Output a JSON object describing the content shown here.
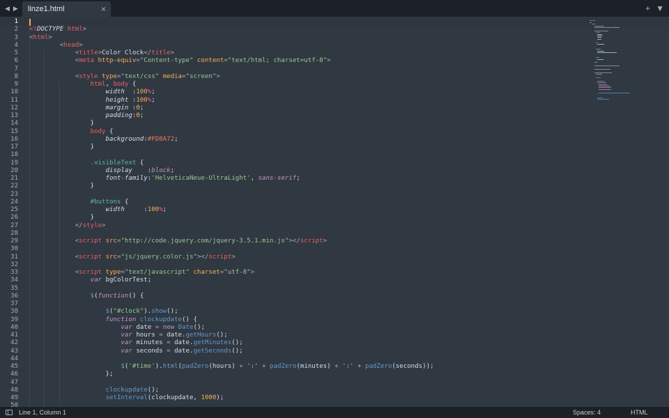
{
  "tab": {
    "title": "linze1.html",
    "close_glyph": "×"
  },
  "nav": {
    "back_glyph": "◀",
    "forward_glyph": "▶"
  },
  "tabbar_right": {
    "new_tab_glyph": "+",
    "menu_glyph": "▼"
  },
  "status": {
    "position": "Line 1, Column 1",
    "spaces": "Spaces: 4",
    "syntax": "HTML"
  },
  "colors": {
    "background": "#303841",
    "bar": "#1b2127",
    "tag": "#ec5f66",
    "attribute": "#f9ae58",
    "string": "#99c794",
    "keyword": "#c695c6",
    "function": "#6699cc"
  },
  "icons": {
    "sidebar_toggle": "sidebar-toggle-icon",
    "back": "chevron-left-icon",
    "forward": "chevron-right-icon",
    "new_tab": "plus-icon",
    "menu": "chevron-down-icon",
    "close": "close-icon"
  },
  "editor": {
    "active_line": 1,
    "lines": [
      [],
      [
        [
          "t",
          "<!"
        ],
        [
          "it",
          "DOCTYPE "
        ],
        [
          "t",
          "html"
        ],
        [
          "cm",
          ">"
        ]
      ],
      [
        [
          "cm",
          "<"
        ],
        [
          "t",
          "html"
        ],
        [
          "cm",
          ">"
        ]
      ],
      [
        [
          "",
          "        "
        ],
        [
          "cm",
          "<"
        ],
        [
          "t",
          "head"
        ],
        [
          "cm",
          ">"
        ]
      ],
      [
        [
          "",
          "            "
        ],
        [
          "cm",
          "<"
        ],
        [
          "t",
          "title"
        ],
        [
          "cm",
          ">"
        ],
        [
          "",
          "Color Clock"
        ],
        [
          "cm",
          "</"
        ],
        [
          "t",
          "title"
        ],
        [
          "cm",
          ">"
        ]
      ],
      [
        [
          "",
          "            "
        ],
        [
          "cm",
          "<"
        ],
        [
          "t",
          "meta "
        ],
        [
          "a",
          "http-equiv"
        ],
        [
          "cm",
          "="
        ],
        [
          "s",
          "\"Content-type\""
        ],
        [
          "a",
          " content"
        ],
        [
          "cm",
          "="
        ],
        [
          "s",
          "\"text/html; charset=utf-8\""
        ],
        [
          "cm",
          ">"
        ]
      ],
      [],
      [
        [
          "",
          "            "
        ],
        [
          "cm",
          "<"
        ],
        [
          "t",
          "style "
        ],
        [
          "a",
          "type"
        ],
        [
          "cm",
          "="
        ],
        [
          "s",
          "\"text/css\""
        ],
        [
          "a",
          " media"
        ],
        [
          "cm",
          "="
        ],
        [
          "s",
          "\"screen\""
        ],
        [
          "cm",
          ">"
        ]
      ],
      [
        [
          "",
          "                "
        ],
        [
          "t",
          "html"
        ],
        [
          "",
          ", "
        ],
        [
          "t",
          "body"
        ],
        [
          "",
          " {"
        ]
      ],
      [
        [
          "",
          "                    "
        ],
        [
          "it",
          "width"
        ],
        [
          "",
          "  :"
        ],
        [
          "n",
          "100"
        ],
        [
          "t",
          "%"
        ],
        [
          "",
          ";"
        ]
      ],
      [
        [
          "",
          "                    "
        ],
        [
          "it",
          "height"
        ],
        [
          "",
          " :"
        ],
        [
          "n",
          "100"
        ],
        [
          "t",
          "%"
        ],
        [
          "",
          ";"
        ]
      ],
      [
        [
          "",
          "                    "
        ],
        [
          "it",
          "margin"
        ],
        [
          "",
          " :"
        ],
        [
          "n",
          "0"
        ],
        [
          "",
          ";"
        ]
      ],
      [
        [
          "",
          "                    "
        ],
        [
          "it",
          "padding"
        ],
        [
          "",
          ":"
        ],
        [
          "n",
          "0"
        ],
        [
          "",
          ";"
        ]
      ],
      [
        [
          "",
          "                }"
        ]
      ],
      [
        [
          "",
          "                "
        ],
        [
          "t",
          "body"
        ],
        [
          "",
          " {"
        ]
      ],
      [
        [
          "",
          "                    "
        ],
        [
          "it",
          "background"
        ],
        [
          "",
          ":"
        ],
        [
          "c",
          "#FD8A72"
        ],
        [
          "",
          ";"
        ]
      ],
      [
        [
          "",
          "                }"
        ]
      ],
      [],
      [
        [
          "",
          "                "
        ],
        [
          "p",
          ".visibleText"
        ],
        [
          "",
          " {"
        ]
      ],
      [
        [
          "",
          "                    "
        ],
        [
          "it",
          "display"
        ],
        [
          "",
          "    :"
        ],
        [
          "v",
          "block"
        ],
        [
          "",
          ";"
        ]
      ],
      [
        [
          "",
          "                    "
        ],
        [
          "it",
          "font-family"
        ],
        [
          "",
          ":"
        ],
        [
          "s",
          "'HelveticaNeue-UltraLight'"
        ],
        [
          "",
          ", "
        ],
        [
          "v",
          "sans-serif"
        ],
        [
          "",
          ";"
        ]
      ],
      [
        [
          "",
          "                }"
        ]
      ],
      [],
      [
        [
          "",
          "                "
        ],
        [
          "p",
          "#buttons"
        ],
        [
          "",
          " {"
        ]
      ],
      [
        [
          "",
          "                    "
        ],
        [
          "it",
          "width"
        ],
        [
          "",
          "     :"
        ],
        [
          "n",
          "100"
        ],
        [
          "t",
          "%"
        ],
        [
          "",
          ";"
        ]
      ],
      [
        [
          "",
          "                }"
        ]
      ],
      [
        [
          "",
          "            "
        ],
        [
          "cm",
          "</"
        ],
        [
          "t",
          "style"
        ],
        [
          "cm",
          ">"
        ]
      ],
      [],
      [
        [
          "",
          "            "
        ],
        [
          "cm",
          "<"
        ],
        [
          "t",
          "script "
        ],
        [
          "a",
          "src"
        ],
        [
          "cm",
          "="
        ],
        [
          "s",
          "\"http://code.jquery.com/jquery-3.5.1.min.js\""
        ],
        [
          "cm",
          "></"
        ],
        [
          "t",
          "script"
        ],
        [
          "cm",
          ">"
        ]
      ],
      [],
      [
        [
          "",
          "            "
        ],
        [
          "cm",
          "<"
        ],
        [
          "t",
          "script "
        ],
        [
          "a",
          "src"
        ],
        [
          "cm",
          "="
        ],
        [
          "s",
          "\"js/jquery.color.js\""
        ],
        [
          "cm",
          "></"
        ],
        [
          "t",
          "script"
        ],
        [
          "cm",
          ">"
        ]
      ],
      [],
      [
        [
          "",
          "            "
        ],
        [
          "cm",
          "<"
        ],
        [
          "t",
          "script "
        ],
        [
          "a",
          "type"
        ],
        [
          "cm",
          "="
        ],
        [
          "s",
          "\"text/javascript\""
        ],
        [
          "a",
          " charset"
        ],
        [
          "cm",
          "="
        ],
        [
          "s",
          "\"utf-8\""
        ],
        [
          "cm",
          ">"
        ]
      ],
      [
        [
          "",
          "                "
        ],
        [
          "k",
          "var"
        ],
        [
          "",
          " bgColorTest;"
        ]
      ],
      [],
      [
        [
          "",
          "                "
        ],
        [
          "f",
          "$"
        ],
        [
          "",
          "("
        ],
        [
          "k",
          "function"
        ],
        [
          "",
          "() {"
        ]
      ],
      [],
      [
        [
          "",
          "                    "
        ],
        [
          "f",
          "$"
        ],
        [
          "",
          "("
        ],
        [
          "s",
          "\"#clock\""
        ],
        [
          "",
          ")."
        ],
        [
          "f",
          "show"
        ],
        [
          "",
          "();"
        ]
      ],
      [
        [
          "",
          "                    "
        ],
        [
          "k",
          "function"
        ],
        [
          "",
          " "
        ],
        [
          "f",
          "clockupdate"
        ],
        [
          "",
          "() {"
        ]
      ],
      [
        [
          "",
          "                        "
        ],
        [
          "k",
          "var"
        ],
        [
          "",
          " date "
        ],
        [
          "kn",
          "="
        ],
        [
          "",
          " "
        ],
        [
          "kn",
          "new"
        ],
        [
          "",
          " "
        ],
        [
          "f",
          "Date"
        ],
        [
          "",
          "();"
        ]
      ],
      [
        [
          "",
          "                        "
        ],
        [
          "k",
          "var"
        ],
        [
          "",
          " hours "
        ],
        [
          "kn",
          "="
        ],
        [
          "",
          " date."
        ],
        [
          "f",
          "getHours"
        ],
        [
          "",
          "();"
        ]
      ],
      [
        [
          "",
          "                        "
        ],
        [
          "k",
          "var"
        ],
        [
          "",
          " minutes "
        ],
        [
          "kn",
          "="
        ],
        [
          "",
          " date."
        ],
        [
          "f",
          "getMinutes"
        ],
        [
          "",
          "();"
        ]
      ],
      [
        [
          "",
          "                        "
        ],
        [
          "k",
          "var"
        ],
        [
          "",
          " seconds "
        ],
        [
          "kn",
          "="
        ],
        [
          "",
          " date."
        ],
        [
          "f",
          "getSeconds"
        ],
        [
          "",
          "();"
        ]
      ],
      [],
      [
        [
          "",
          "                        "
        ],
        [
          "f",
          "$"
        ],
        [
          "",
          "("
        ],
        [
          "s",
          "'#time'"
        ],
        [
          "",
          ")."
        ],
        [
          "f",
          "html"
        ],
        [
          "",
          "("
        ],
        [
          "f",
          "padZero"
        ],
        [
          "",
          "(hours) "
        ],
        [
          "kn",
          "+"
        ],
        [
          "",
          " "
        ],
        [
          "s",
          "':'"
        ],
        [
          "",
          " "
        ],
        [
          "kn",
          "+"
        ],
        [
          "",
          " "
        ],
        [
          "f",
          "padZero"
        ],
        [
          "",
          "(minutes) "
        ],
        [
          "kn",
          "+"
        ],
        [
          "",
          " "
        ],
        [
          "s",
          "':'"
        ],
        [
          "",
          " "
        ],
        [
          "kn",
          "+"
        ],
        [
          "",
          " "
        ],
        [
          "f",
          "padZero"
        ],
        [
          "",
          "(seconds));"
        ]
      ],
      [
        [
          "",
          "                    };"
        ]
      ],
      [],
      [
        [
          "",
          "                    "
        ],
        [
          "f",
          "clockupdate"
        ],
        [
          "",
          "();"
        ]
      ],
      [
        [
          "",
          "                    "
        ],
        [
          "f",
          "setInterval"
        ],
        [
          "",
          "(clockupdate, "
        ],
        [
          "n",
          "1000"
        ],
        [
          "",
          ");"
        ]
      ],
      []
    ]
  }
}
